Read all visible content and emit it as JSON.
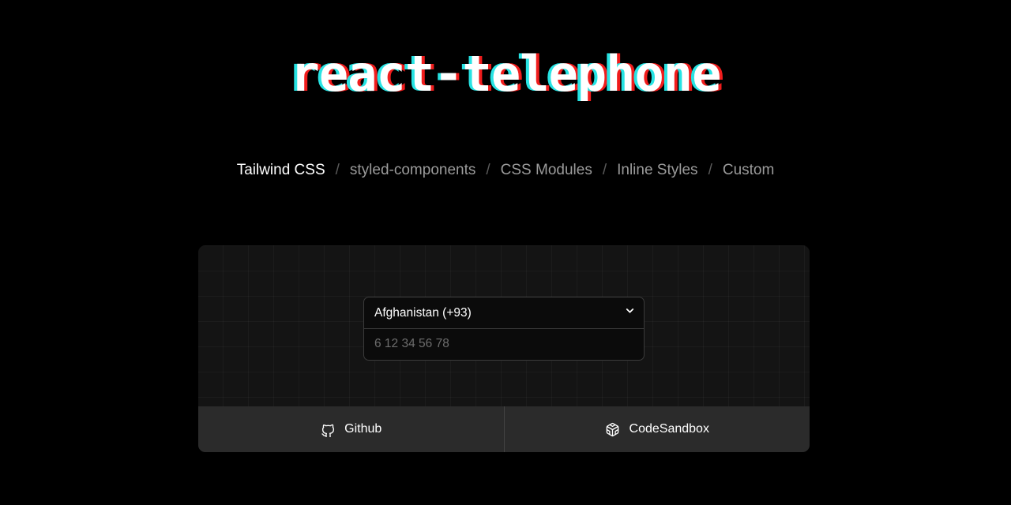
{
  "page": {
    "background_color": "#000000",
    "title": "react-telephone",
    "title_effect": {
      "name": "chromatic-aberration",
      "left_color": "#27e3e3",
      "right_color": "#f01c1c",
      "text_color": "#ffffff"
    }
  },
  "nav": {
    "separator": "/",
    "items": [
      {
        "label": "Tailwind CSS",
        "active": true
      },
      {
        "label": "styled-components",
        "active": false
      },
      {
        "label": "CSS Modules",
        "active": false
      },
      {
        "label": "Inline Styles",
        "active": false
      },
      {
        "label": "Custom",
        "active": false
      }
    ]
  },
  "demo": {
    "country_select": {
      "selected": "Afghanistan (+93)",
      "chevron_icon": "chevron-down-icon",
      "options": [
        "Afghanistan (+93)"
      ]
    },
    "phone_input": {
      "value": "",
      "placeholder": "6 12 34 56 78"
    }
  },
  "footer": {
    "links": [
      {
        "label": "Github",
        "icon": "github-icon"
      },
      {
        "label": "CodeSandbox",
        "icon": "codesandbox-icon"
      }
    ]
  }
}
